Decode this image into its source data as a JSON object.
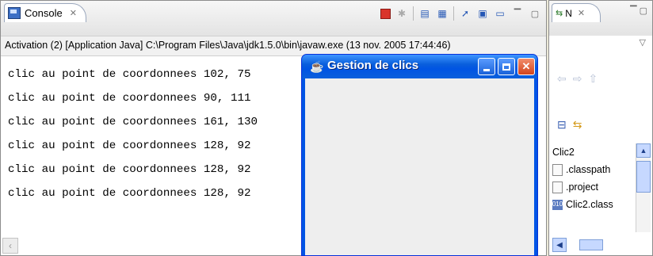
{
  "console": {
    "tab_label": "Console",
    "tab_close": "✕",
    "launch_info": "Activation (2) [Application Java] C:\\Program Files\\Java\\jdk1.5.0\\bin\\javaw.exe (13 nov. 2005 17:44:46)",
    "output_lines": [
      "clic au point de coordonnees 102, 75",
      "clic au point de coordonnees 90, 111",
      "clic au point de coordonnees 161, 130",
      "clic au point de coordonnees 128, 92",
      "clic au point de coordonnees 128, 92",
      "clic au point de coordonnees 128, 92"
    ],
    "toolbar_icons": [
      "terminate-icon",
      "remove-launches-icon",
      "clear-console-icon",
      "scroll-lock-icon",
      "pin-console-icon",
      "display-console-icon",
      "open-console-icon",
      "minimize-icon",
      "maximize-icon"
    ]
  },
  "navigator": {
    "tab_label": "N",
    "tab_close": "✕",
    "tree": [
      {
        "label": "Clic2",
        "icon": "project-icon"
      },
      {
        "label": ".classpath",
        "icon": "file-icon"
      },
      {
        "label": ".project",
        "icon": "file-icon"
      },
      {
        "label": "Clic2.class",
        "icon": "class-file-icon"
      }
    ]
  },
  "swing_window": {
    "title": "Gestion de clics"
  }
}
